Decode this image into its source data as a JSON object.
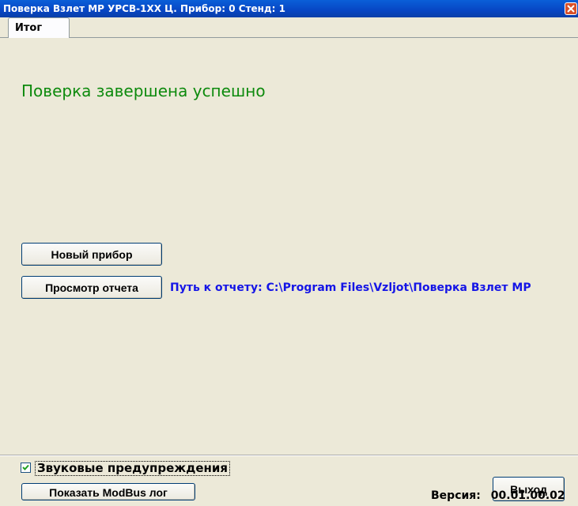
{
  "window": {
    "title": "Поверка Взлет МР УРСВ-1ХХ Ц. Прибор: 0 Стенд: 1"
  },
  "tabs": [
    {
      "label": "Итог"
    }
  ],
  "result": {
    "message": "Поверка завершена успешно",
    "message_color": "#0d8a0d"
  },
  "actions": {
    "new_device_label": "Новый прибор",
    "view_report_label": "Просмотр отчета",
    "report_path_label": "Путь к отчету:",
    "report_path_value": "C:\\Program Files\\Vzljot\\Поверка Взлет МР"
  },
  "footer": {
    "sound_warnings_label": "Звуковые предупреждения",
    "sound_warnings_checked": true,
    "show_modbus_log_label": "Показать ModBus лог",
    "exit_label": "Выход",
    "version_label": "Версия:",
    "version_value": "00.01.00.02"
  },
  "icons": {
    "close": "close-icon",
    "check": "checkmark-icon"
  }
}
